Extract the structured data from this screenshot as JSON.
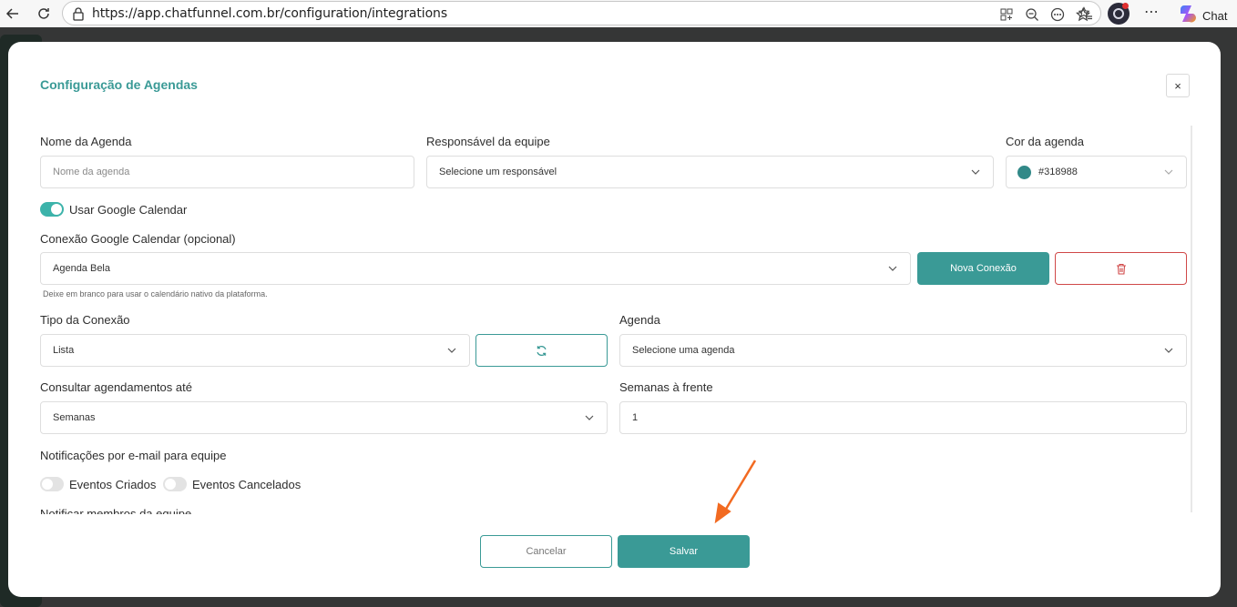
{
  "browser": {
    "url": "https://app.chatfunnel.com.br/configuration/integrations",
    "chat_label": "Chat"
  },
  "modal": {
    "title": "Configuração de Agendas",
    "close_symbol": "×",
    "nome": {
      "label": "Nome da Agenda",
      "placeholder": "Nome da agenda"
    },
    "responsavel": {
      "label": "Responsável da equipe",
      "value": "Selecione um responsável"
    },
    "cor": {
      "label": "Cor da agenda",
      "value": "#318988",
      "swatch": "#318988"
    },
    "google_toggle": {
      "label": "Usar Google Calendar",
      "on": true
    },
    "conexao": {
      "label": "Conexão Google Calendar (opcional)",
      "value": "Agenda Bela",
      "hint": "Deixe em branco para usar o calendário nativo da plataforma.",
      "new_button": "Nova Conexão"
    },
    "tipo": {
      "label": "Tipo da Conexão",
      "value": "Lista"
    },
    "agenda": {
      "label": "Agenda",
      "value": "Selecione uma agenda"
    },
    "consultar": {
      "label": "Consultar agendamentos até",
      "value": "Semanas"
    },
    "semanas": {
      "label": "Semanas à frente",
      "value": "1"
    },
    "notificacoes": {
      "label": "Notificações por e-mail para equipe",
      "eventos_criados": "Eventos Criados",
      "eventos_cancelados": "Eventos Cancelados"
    },
    "notificar_membros": "Notificar membros da equipe",
    "cancel_button": "Cancelar",
    "save_button": "Salvar"
  },
  "colors": {
    "accent": "#3a9a96",
    "danger": "#d04848",
    "arrow": "#f26a21"
  }
}
